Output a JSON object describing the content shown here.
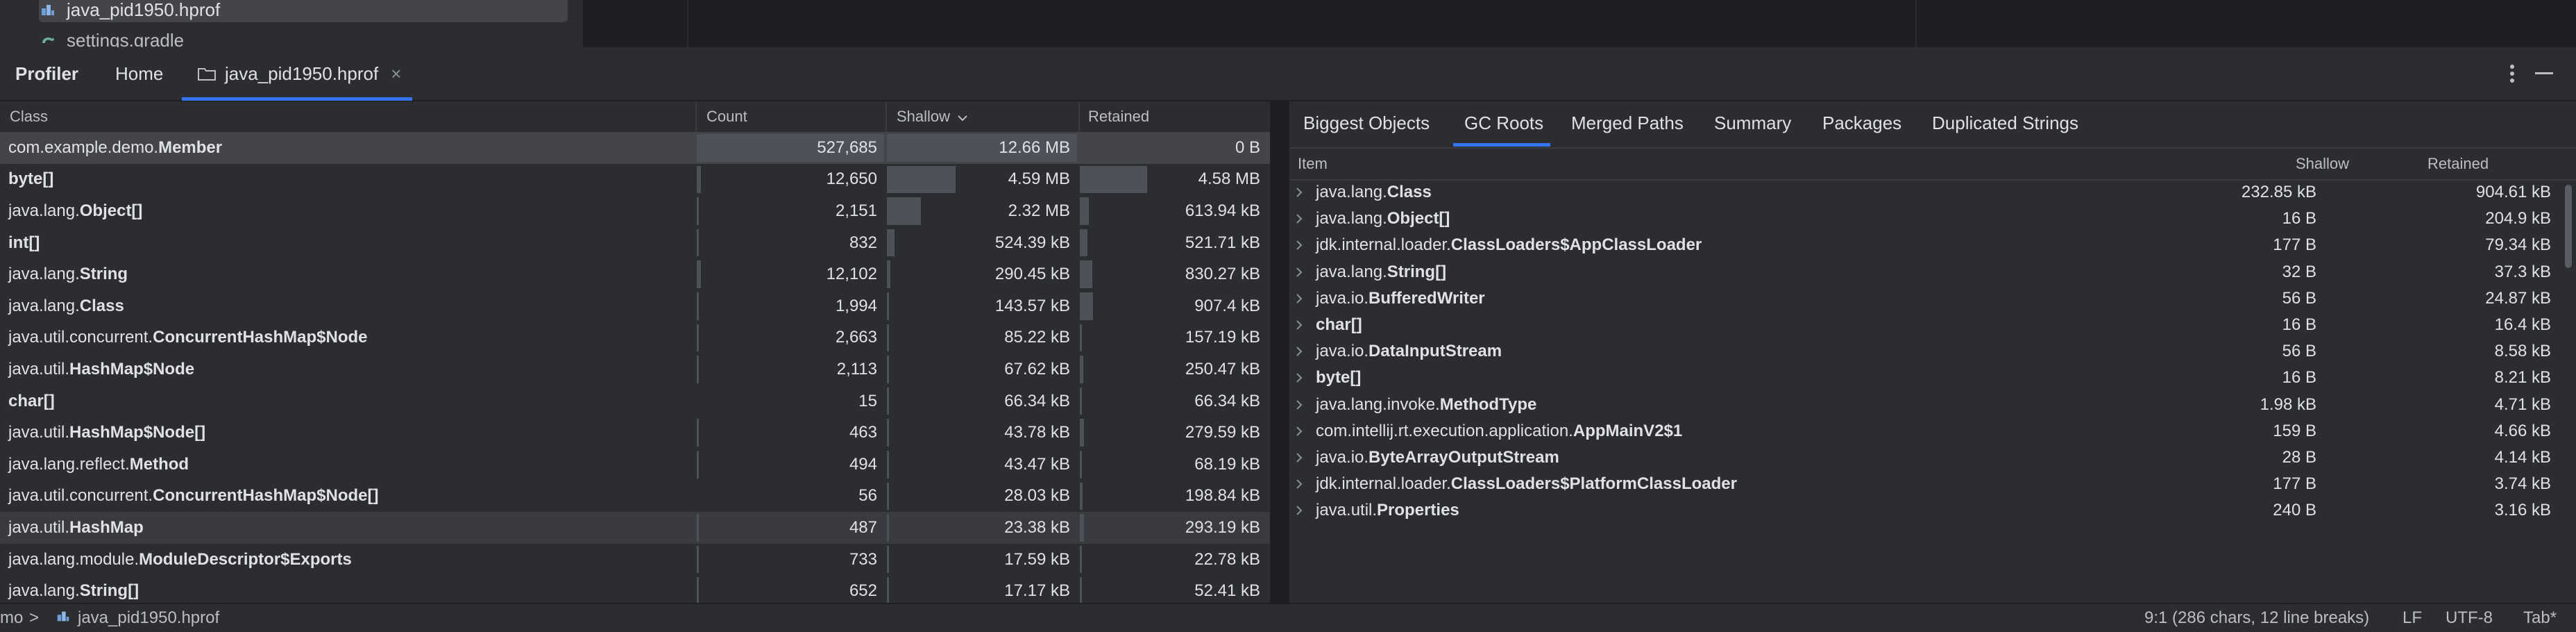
{
  "project_tree": {
    "items": [
      {
        "label": "java_pid1950.hprof",
        "icon": "hprof-file-icon",
        "selected": true
      },
      {
        "label": "settings.gradle",
        "icon": "gradle-file-icon",
        "selected": false
      }
    ]
  },
  "tabs": {
    "profiler": "Profiler",
    "home": "Home",
    "file": "java_pid1950.hprof",
    "close_icon": "close-icon",
    "more_icon": "more-vertical-icon",
    "minimize_icon": "minimize-icon"
  },
  "class_table": {
    "headers": {
      "class": "Class",
      "count": "Count",
      "shallow": "Shallow",
      "retained": "Retained"
    },
    "sort_column": "shallow",
    "sort_direction": "descending",
    "rows": [
      {
        "pkg": "com.example.demo.",
        "name": "Member",
        "count": "527,685",
        "shallow": "12.66 MB",
        "retained": "0 B",
        "count_frac": 1.0,
        "shallow_frac": 1.0,
        "retained_frac": 0
      },
      {
        "pkg": "",
        "name": "byte[]",
        "count": "12,650",
        "shallow": "4.59 MB",
        "retained": "4.58 MB",
        "count_frac": 0.024,
        "shallow_frac": 0.36,
        "retained_frac": 0.36
      },
      {
        "pkg": "java.lang.",
        "name": "Object[]",
        "count": "2,151",
        "shallow": "2.32 MB",
        "retained": "613.94 kB",
        "count_frac": 0.004,
        "shallow_frac": 0.18,
        "retained_frac": 0.048
      },
      {
        "pkg": "",
        "name": "int[]",
        "count": "832",
        "shallow": "524.39 kB",
        "retained": "521.71 kB",
        "count_frac": 0.002,
        "shallow_frac": 0.04,
        "retained_frac": 0.04
      },
      {
        "pkg": "java.lang.",
        "name": "String",
        "count": "12,102",
        "shallow": "290.45 kB",
        "retained": "830.27 kB",
        "count_frac": 0.023,
        "shallow_frac": 0.02,
        "retained_frac": 0.065
      },
      {
        "pkg": "java.lang.",
        "name": "Class",
        "count": "1,994",
        "shallow": "143.57 kB",
        "retained": "907.4 kB",
        "count_frac": 0.004,
        "shallow_frac": 0.01,
        "retained_frac": 0.07
      },
      {
        "pkg": "java.util.concurrent.",
        "name": "ConcurrentHashMap$Node",
        "count": "2,663",
        "shallow": "85.22 kB",
        "retained": "157.19 kB",
        "count_frac": 0.005,
        "shallow_frac": 0.007,
        "retained_frac": 0.012
      },
      {
        "pkg": "java.util.",
        "name": "HashMap$Node",
        "count": "2,113",
        "shallow": "67.62 kB",
        "retained": "250.47 kB",
        "count_frac": 0.004,
        "shallow_frac": 0.005,
        "retained_frac": 0.02
      },
      {
        "pkg": "",
        "name": "char[]",
        "count": "15",
        "shallow": "66.34 kB",
        "retained": "66.34 kB",
        "count_frac": 0,
        "shallow_frac": 0.005,
        "retained_frac": 0.005
      },
      {
        "pkg": "java.util.",
        "name": "HashMap$Node[]",
        "count": "463",
        "shallow": "43.78 kB",
        "retained": "279.59 kB",
        "count_frac": 0.001,
        "shallow_frac": 0.003,
        "retained_frac": 0.022
      },
      {
        "pkg": "java.lang.reflect.",
        "name": "Method",
        "count": "494",
        "shallow": "43.47 kB",
        "retained": "68.19 kB",
        "count_frac": 0.001,
        "shallow_frac": 0.003,
        "retained_frac": 0.005
      },
      {
        "pkg": "java.util.concurrent.",
        "name": "ConcurrentHashMap$Node[]",
        "count": "56",
        "shallow": "28.03 kB",
        "retained": "198.84 kB",
        "count_frac": 0,
        "shallow_frac": 0.002,
        "retained_frac": 0.016
      },
      {
        "pkg": "java.util.",
        "name": "HashMap",
        "count": "487",
        "shallow": "23.38 kB",
        "retained": "293.19 kB",
        "count_frac": 0.001,
        "shallow_frac": 0.002,
        "retained_frac": 0.023
      },
      {
        "pkg": "java.lang.module.",
        "name": "ModuleDescriptor$Exports",
        "count": "733",
        "shallow": "17.59 kB",
        "retained": "22.78 kB",
        "count_frac": 0.001,
        "shallow_frac": 0.001,
        "retained_frac": 0.002
      },
      {
        "pkg": "java.lang.",
        "name": "String[]",
        "count": "652",
        "shallow": "17.17 kB",
        "retained": "52.41 kB",
        "count_frac": 0.001,
        "shallow_frac": 0.001,
        "retained_frac": 0.004
      }
    ]
  },
  "analysis": {
    "tabs": [
      "Biggest Objects",
      "GC Roots",
      "Merged Paths",
      "Summary",
      "Packages",
      "Duplicated Strings"
    ],
    "active_tab": "GC Roots",
    "headers": {
      "item": "Item",
      "shallow": "Shallow",
      "retained": "Retained"
    },
    "rows": [
      {
        "pkg": "java.lang.",
        "name": "Class",
        "shallow": "232.85 kB",
        "retained": "904.61 kB"
      },
      {
        "pkg": "java.lang.",
        "name": "Object[]",
        "shallow": "16 B",
        "retained": "204.9 kB"
      },
      {
        "pkg": "jdk.internal.loader.",
        "name": "ClassLoaders$AppClassLoader",
        "shallow": "177 B",
        "retained": "79.34 kB"
      },
      {
        "pkg": "java.lang.",
        "name": "String[]",
        "shallow": "32 B",
        "retained": "37.3 kB"
      },
      {
        "pkg": "java.io.",
        "name": "BufferedWriter",
        "shallow": "56 B",
        "retained": "24.87 kB"
      },
      {
        "pkg": "",
        "name": "char[]",
        "shallow": "16 B",
        "retained": "16.4 kB"
      },
      {
        "pkg": "java.io.",
        "name": "DataInputStream",
        "shallow": "56 B",
        "retained": "8.58 kB"
      },
      {
        "pkg": "",
        "name": "byte[]",
        "shallow": "16 B",
        "retained": "8.21 kB"
      },
      {
        "pkg": "java.lang.invoke.",
        "name": "MethodType",
        "shallow": "1.98 kB",
        "retained": "4.71 kB"
      },
      {
        "pkg": "com.intellij.rt.execution.application.",
        "name": "AppMainV2$1",
        "shallow": "159 B",
        "retained": "4.66 kB"
      },
      {
        "pkg": "java.io.",
        "name": "ByteArrayOutputStream",
        "shallow": "28 B",
        "retained": "4.14 kB"
      },
      {
        "pkg": "jdk.internal.loader.",
        "name": "ClassLoaders$PlatformClassLoader",
        "shallow": "177 B",
        "retained": "3.74 kB"
      },
      {
        "pkg": "java.util.",
        "name": "Properties",
        "shallow": "240 B",
        "retained": "3.16 kB"
      }
    ]
  },
  "status_bar": {
    "breadcrumb_start": "mo",
    "breadcrumb_sep": ">",
    "breadcrumb_file": "java_pid1950.hprof",
    "position": "9:1 (286 chars, 12 line breaks)",
    "line_sep": "LF",
    "encoding": "UTF-8",
    "indent": "Tab*"
  },
  "colors": {
    "accent": "#3574f0",
    "panel_bg": "#2b2d30",
    "selection_bg": "#43454a",
    "bar_fill": "#4e5157"
  }
}
